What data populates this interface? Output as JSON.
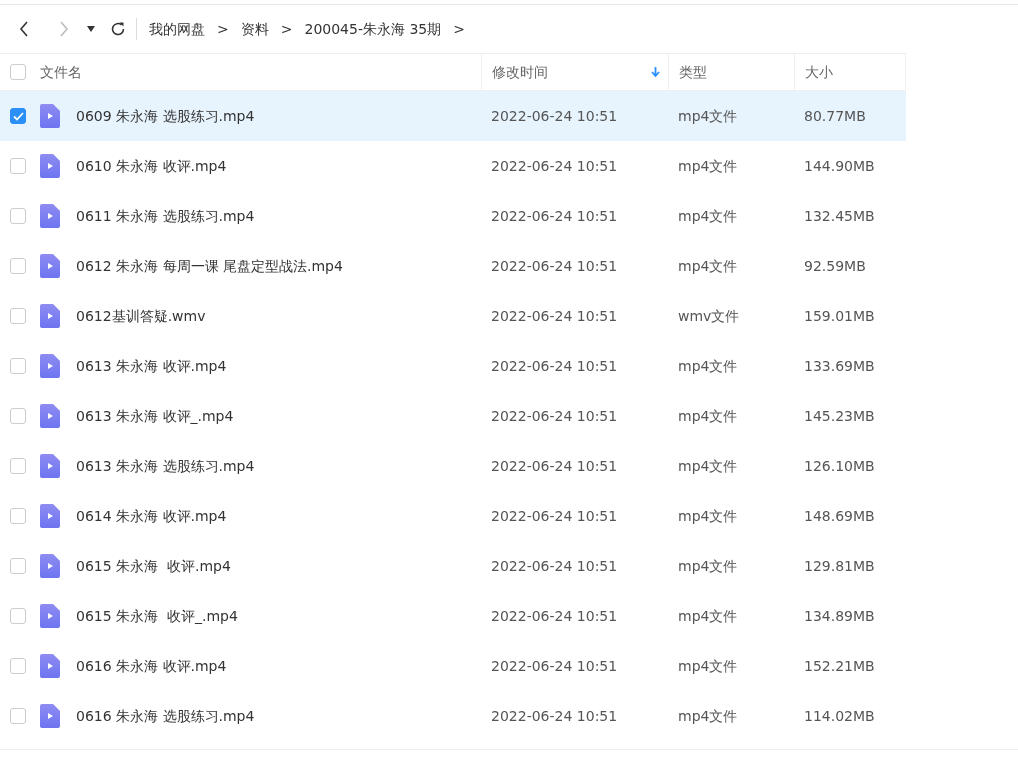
{
  "toolbar": {
    "breadcrumbs": [
      "我的网盘",
      "资料",
      "200045-朱永海 35期"
    ],
    "separators": [
      ">",
      ">",
      ">"
    ]
  },
  "table": {
    "columns": [
      {
        "label": "文件名",
        "sorted": false
      },
      {
        "label": "修改时间",
        "sorted": true
      },
      {
        "label": "类型",
        "sorted": false
      },
      {
        "label": "大小",
        "sorted": false
      }
    ],
    "select_all_checked": false,
    "rows": [
      {
        "name": "0609 朱永海 选股练习.mp4",
        "modified": "2022-06-24 10:51",
        "type": "mp4文件",
        "size": "80.77MB",
        "selected": true
      },
      {
        "name": "0610 朱永海 收评.mp4",
        "modified": "2022-06-24 10:51",
        "type": "mp4文件",
        "size": "144.90MB",
        "selected": false
      },
      {
        "name": "0611 朱永海 选股练习.mp4",
        "modified": "2022-06-24 10:51",
        "type": "mp4文件",
        "size": "132.45MB",
        "selected": false
      },
      {
        "name": "0612 朱永海 每周一课 尾盘定型战法.mp4",
        "modified": "2022-06-24 10:51",
        "type": "mp4文件",
        "size": "92.59MB",
        "selected": false
      },
      {
        "name": "0612基训答疑.wmv",
        "modified": "2022-06-24 10:51",
        "type": "wmv文件",
        "size": "159.01MB",
        "selected": false
      },
      {
        "name": "0613 朱永海 收评.mp4",
        "modified": "2022-06-24 10:51",
        "type": "mp4文件",
        "size": "133.69MB",
        "selected": false
      },
      {
        "name": "0613 朱永海 收评_.mp4",
        "modified": "2022-06-24 10:51",
        "type": "mp4文件",
        "size": "145.23MB",
        "selected": false
      },
      {
        "name": "0613 朱永海 选股练习.mp4",
        "modified": "2022-06-24 10:51",
        "type": "mp4文件",
        "size": "126.10MB",
        "selected": false
      },
      {
        "name": "0614 朱永海 收评.mp4",
        "modified": "2022-06-24 10:51",
        "type": "mp4文件",
        "size": "148.69MB",
        "selected": false
      },
      {
        "name": "0615 朱永海  收评.mp4",
        "modified": "2022-06-24 10:51",
        "type": "mp4文件",
        "size": "129.81MB",
        "selected": false
      },
      {
        "name": "0615 朱永海  收评_.mp4",
        "modified": "2022-06-24 10:51",
        "type": "mp4文件",
        "size": "134.89MB",
        "selected": false
      },
      {
        "name": "0616 朱永海 收评.mp4",
        "modified": "2022-06-24 10:51",
        "type": "mp4文件",
        "size": "152.21MB",
        "selected": false
      },
      {
        "name": "0616 朱永海 选股练习.mp4",
        "modified": "2022-06-24 10:51",
        "type": "mp4文件",
        "size": "114.02MB",
        "selected": false
      }
    ]
  }
}
